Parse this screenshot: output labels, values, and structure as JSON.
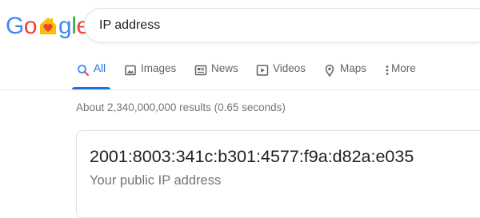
{
  "logo": {
    "letters": [
      {
        "char": "G",
        "color": "#4285F4"
      },
      {
        "char": "o",
        "color": "#EA4335"
      },
      {
        "char": "o",
        "color": "#FBBC05"
      },
      {
        "char": "g",
        "color": "#4285F4"
      },
      {
        "char": "l",
        "color": "#34A853"
      },
      {
        "char": "e",
        "color": "#EA4335"
      }
    ],
    "doodle_icon": "house-heart-icon"
  },
  "search": {
    "value": "IP address"
  },
  "tabs": [
    {
      "label": "All",
      "icon": "search-icon",
      "active": true
    },
    {
      "label": "Images",
      "icon": "image-icon",
      "active": false
    },
    {
      "label": "News",
      "icon": "news-icon",
      "active": false
    },
    {
      "label": "Videos",
      "icon": "play-icon",
      "active": false
    },
    {
      "label": "Maps",
      "icon": "map-pin-icon",
      "active": false
    },
    {
      "label": "More",
      "icon": "kebab-menu-icon",
      "active": false
    }
  ],
  "results": {
    "stats": "About 2,340,000,000 results (0.65 seconds)"
  },
  "answer": {
    "ip": "2001:8003:341c:b301:4577:f9a:d82a:e035",
    "label": "Your public IP address"
  },
  "colors": {
    "accent": "#1a73e8",
    "text": "#202124",
    "muted": "#70757a",
    "tab_text": "#5f6368"
  }
}
